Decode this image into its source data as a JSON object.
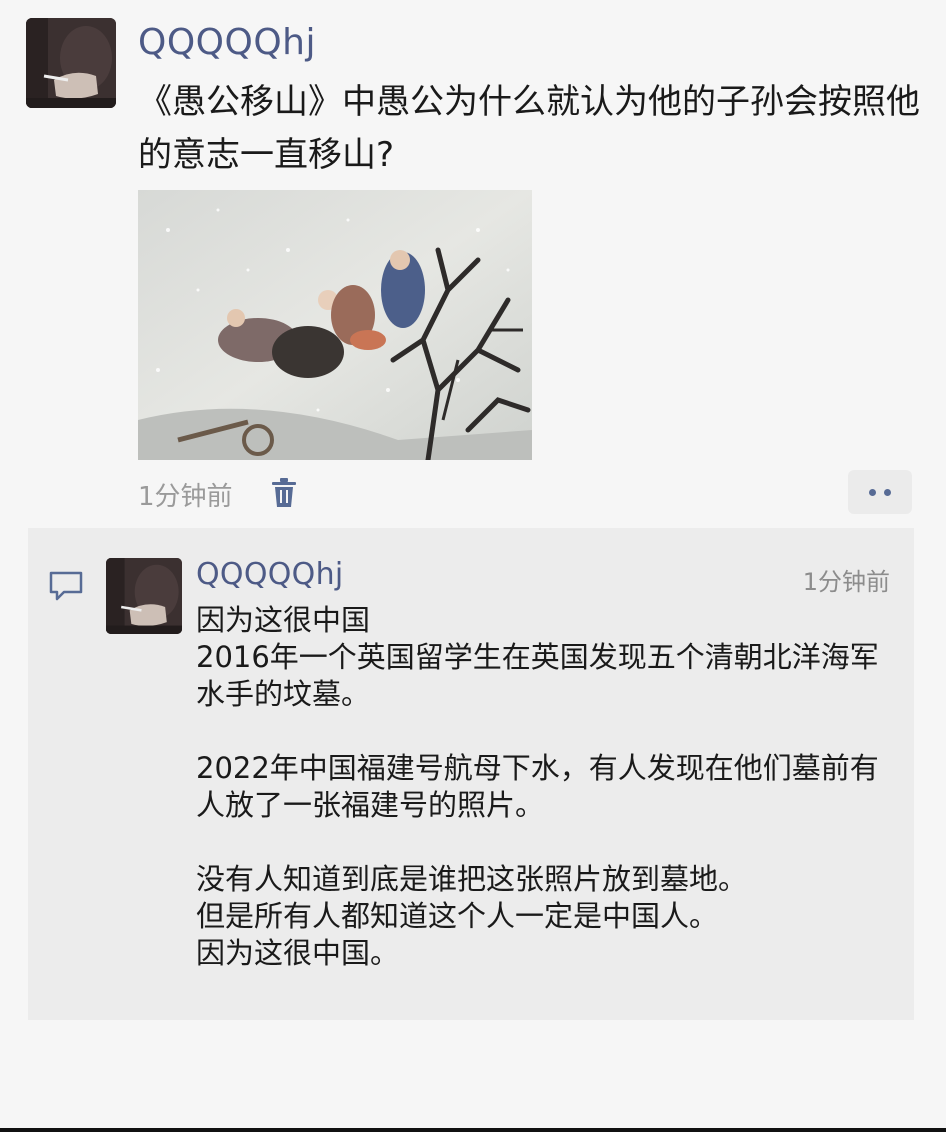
{
  "post": {
    "username": "QQQQQhj",
    "text": "《愚公移山》中愚公为什么就认为他的子孙会按照他的意志一直移山?",
    "time": "1分钟前"
  },
  "comment": {
    "username": "QQQQQhj",
    "time": "1分钟前",
    "paragraphs": [
      "因为这很中国",
      "2016年一个英国留学生在英国发现五个清朝北洋海军水手的坟墓。",
      "2022年中国福建号航母下水，有人发现在他们墓前有人放了一张福建号的照片。",
      "没有人知道到底是谁把这张照片放到墓地。",
      "但是所有人都知道这个人一定是中国人。",
      "因为这很中国。"
    ]
  },
  "icons": {
    "delete": "trash-icon",
    "more": "more-dots-icon",
    "comment": "comment-bubble-icon"
  },
  "colors": {
    "username": "#4d5a86",
    "accent": "#576b95",
    "timestamp": "#9a9a9a",
    "comment_bg": "#ececec"
  }
}
